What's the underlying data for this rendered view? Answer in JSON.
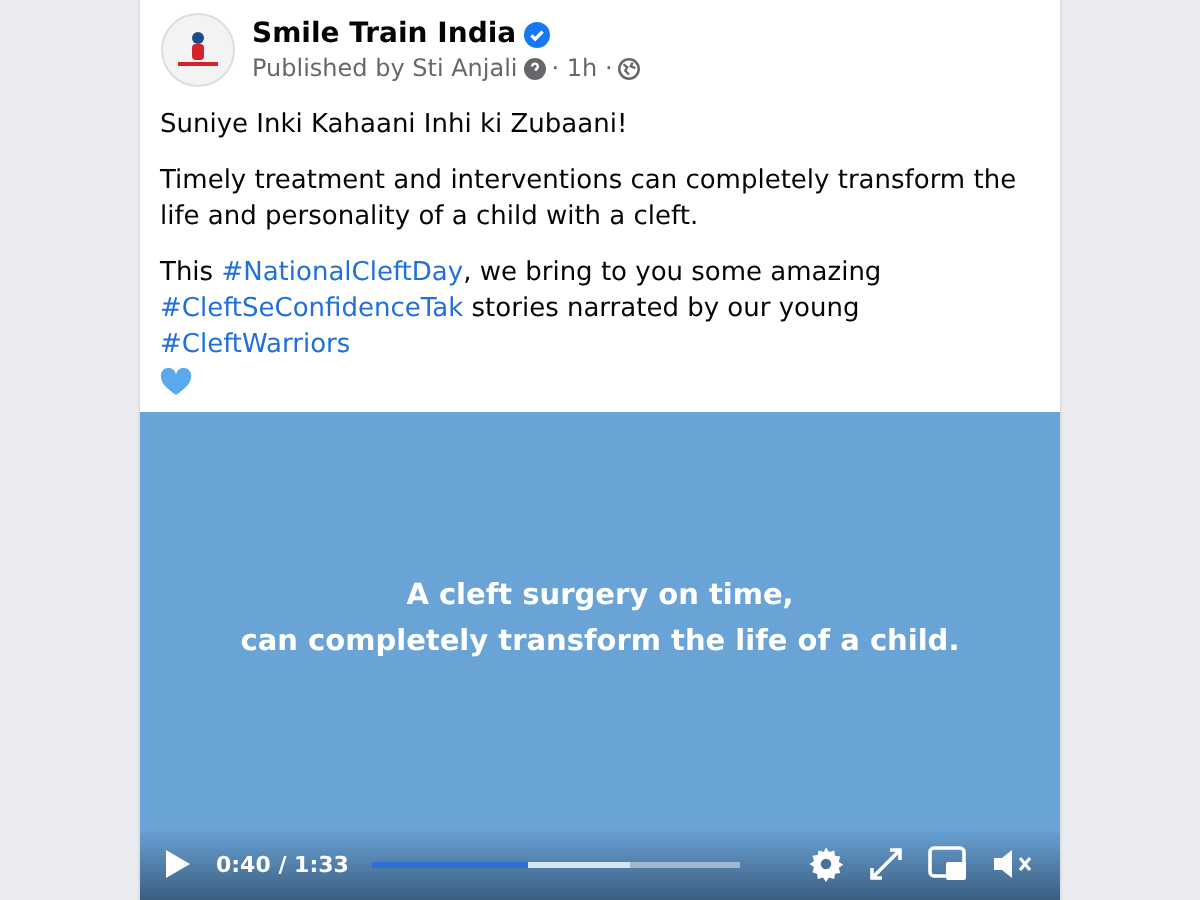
{
  "post": {
    "page_name": "Smile Train India",
    "verified": true,
    "byline": "Published by Sti Anjali",
    "time": "· 1h ·",
    "paragraphs": [
      [
        {
          "kind": "text",
          "text": "Suniye Inki Kahaani Inhi ki Zubaani!"
        }
      ],
      [
        {
          "kind": "text",
          "text": "Timely treatment and interventions can completely transform the life and personality of a child with a cleft."
        }
      ],
      [
        {
          "kind": "text",
          "text": "This "
        },
        {
          "kind": "hashtag",
          "text": "#NationalCleftDay"
        },
        {
          "kind": "text",
          "text": ", we bring to you some amazing "
        },
        {
          "kind": "hashtag",
          "text": "#CleftSeConfidenceTak"
        },
        {
          "kind": "text",
          "text": " stories narrated by our young "
        },
        {
          "kind": "hashtag",
          "text": "#CleftWarriors"
        },
        {
          "kind": "heart"
        }
      ]
    ]
  },
  "video": {
    "caption": [
      "A cleft surgery on time,",
      "can completely transform the life of a child."
    ],
    "time": "0:40 / 1:33",
    "progress": {
      "level": 0.42
    },
    "buffer": {
      "level": 0.7
    },
    "muted": true
  }
}
